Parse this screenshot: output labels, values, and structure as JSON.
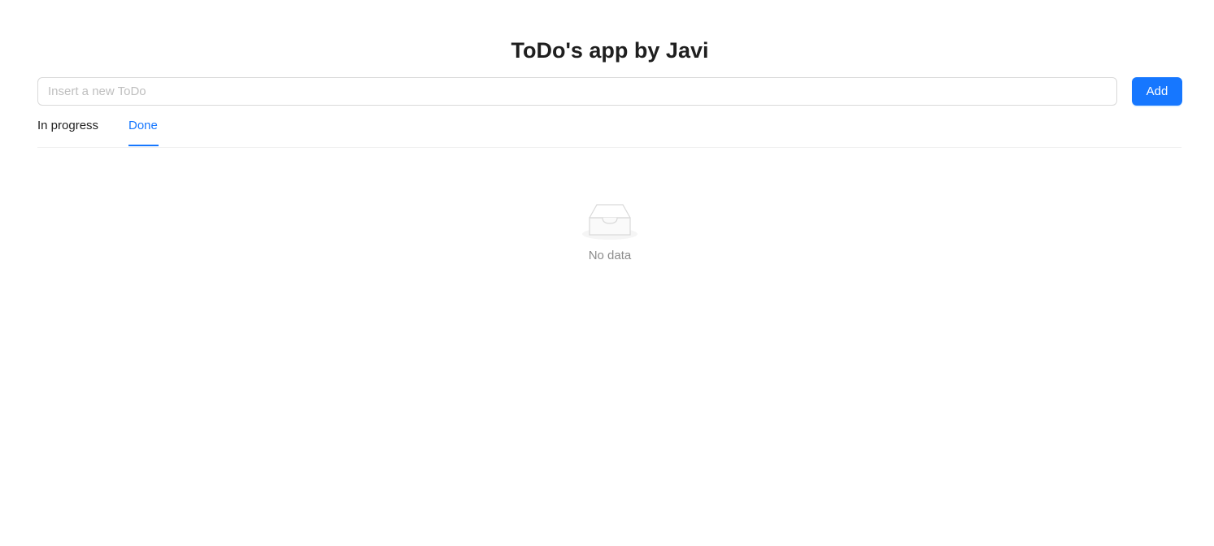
{
  "app": {
    "title": "ToDo's app by Javi"
  },
  "input": {
    "placeholder": "Insert a new ToDo",
    "value": ""
  },
  "add_button": {
    "label": "Add"
  },
  "tabs": [
    {
      "label": "In progress",
      "active": false
    },
    {
      "label": "Done",
      "active": true
    }
  ],
  "empty_state": {
    "icon": "empty-inbox-icon",
    "text": "No data"
  },
  "colors": {
    "primary": "#1677ff",
    "text": "#1f1f1f",
    "muted": "#8c8c8c",
    "border": "#d9d9d9"
  }
}
